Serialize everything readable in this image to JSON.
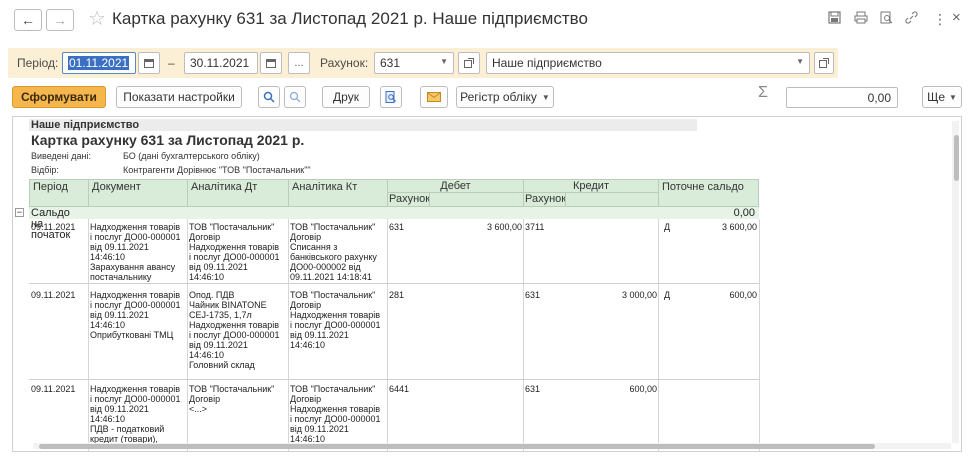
{
  "window": {
    "title": "Картка рахунку 631 за Листопад 2021 р. Наше підприємство",
    "back_glyph": "←",
    "forward_glyph": "→",
    "star_glyph": "☆",
    "more_glyph": "⋮",
    "close_glyph": "×"
  },
  "params": {
    "period_label": "Період:",
    "date_from": "01.11.2021",
    "dash": "–",
    "date_to": "30.11.2021",
    "ellipsis": "...",
    "account_label": "Рахунок:",
    "account_value": "631",
    "org_value": "Наше підприємство"
  },
  "toolbar": {
    "generate": "Сформувати",
    "show_settings": "Показати настройки",
    "print": "Друк",
    "register": "Регістр обліку",
    "sigma": "Σ",
    "sum_value": "0,00",
    "more": "Ще"
  },
  "report": {
    "org": "Наше підприємство",
    "title": "Картка рахунку 631 за Листопад 2021 р.",
    "data_label": "Виведені дані:",
    "data_value": "БО (дані бухгалтерського обліку)",
    "filter_label": "Відбір:",
    "filter_value": "Контрагенти Дорівнює \"ТОВ \"Постачальник\"\"",
    "columns": {
      "period": "Період",
      "document": "Документ",
      "an_dt": "Аналітика Дт",
      "an_kt": "Аналітика Кт",
      "debit": "Дебет",
      "credit": "Кредит",
      "balance": "Поточне сальдо",
      "account": "Рахунок"
    },
    "opening_label": "Сальдо на початок",
    "opening_value": "0,00",
    "rows": [
      {
        "period": "09.11.2021",
        "document": "Надходження товарів\nі послуг ДО00-000001\nвід 09.11.2021\n14:46:10\nЗарахування авансу\nпостачальнику",
        "an_dt": "ТОВ \"Постачальник\"\nДоговір\nНадходження товарів\nі послуг ДО00-000001\nвід 09.11.2021\n14:46:10",
        "an_kt": "ТОВ \"Постачальник\"\nДоговір\nСписання з\nбанківського рахунку\nДО00-000002 від\n09.11.2021 14:18:41",
        "dt_account": "631",
        "dt_sum": "3 600,00",
        "kt_account": "3711",
        "kt_sum": "",
        "bal_side": "Д",
        "bal_sum": "3 600,00"
      },
      {
        "period": "09.11.2021",
        "document": "Надходження товарів\nі послуг ДО00-000001\nвід 09.11.2021\n14:46:10\nОприбутковані ТМЦ",
        "an_dt": "Опод. ПДВ\nЧайник BINATONE\nCEJ-1735,  1,7л\nНадходження товарів\nі послуг ДО00-000001\nвід 09.11.2021\n14:46:10\nГоловний склад",
        "an_kt": "ТОВ \"Постачальник\"\nДоговір\nНадходження товарів\nі послуг ДО00-000001\nвід 09.11.2021\n14:46:10",
        "dt_account": "281",
        "dt_sum": "",
        "kt_account": "631",
        "kt_sum": "3 000,00",
        "bal_side": "Д",
        "bal_sum": "600,00"
      },
      {
        "period": "09.11.2021",
        "document": "Надходження товарів\nі послуг ДО00-000001\nвід 09.11.2021\n14:46:10\nПДВ - податковий\nкредит (товари),",
        "an_dt": "ТОВ \"Постачальник\"\nДоговір\n<...>",
        "an_kt": "ТОВ \"Постачальник\"\nДоговір\nНадходження товарів\nі послуг ДО00-000001\nвід 09.11.2021\n14:46:10",
        "dt_account": "6441",
        "dt_sum": "",
        "kt_account": "631",
        "kt_sum": "600,00",
        "bal_side": "",
        "bal_sum": ""
      }
    ]
  }
}
